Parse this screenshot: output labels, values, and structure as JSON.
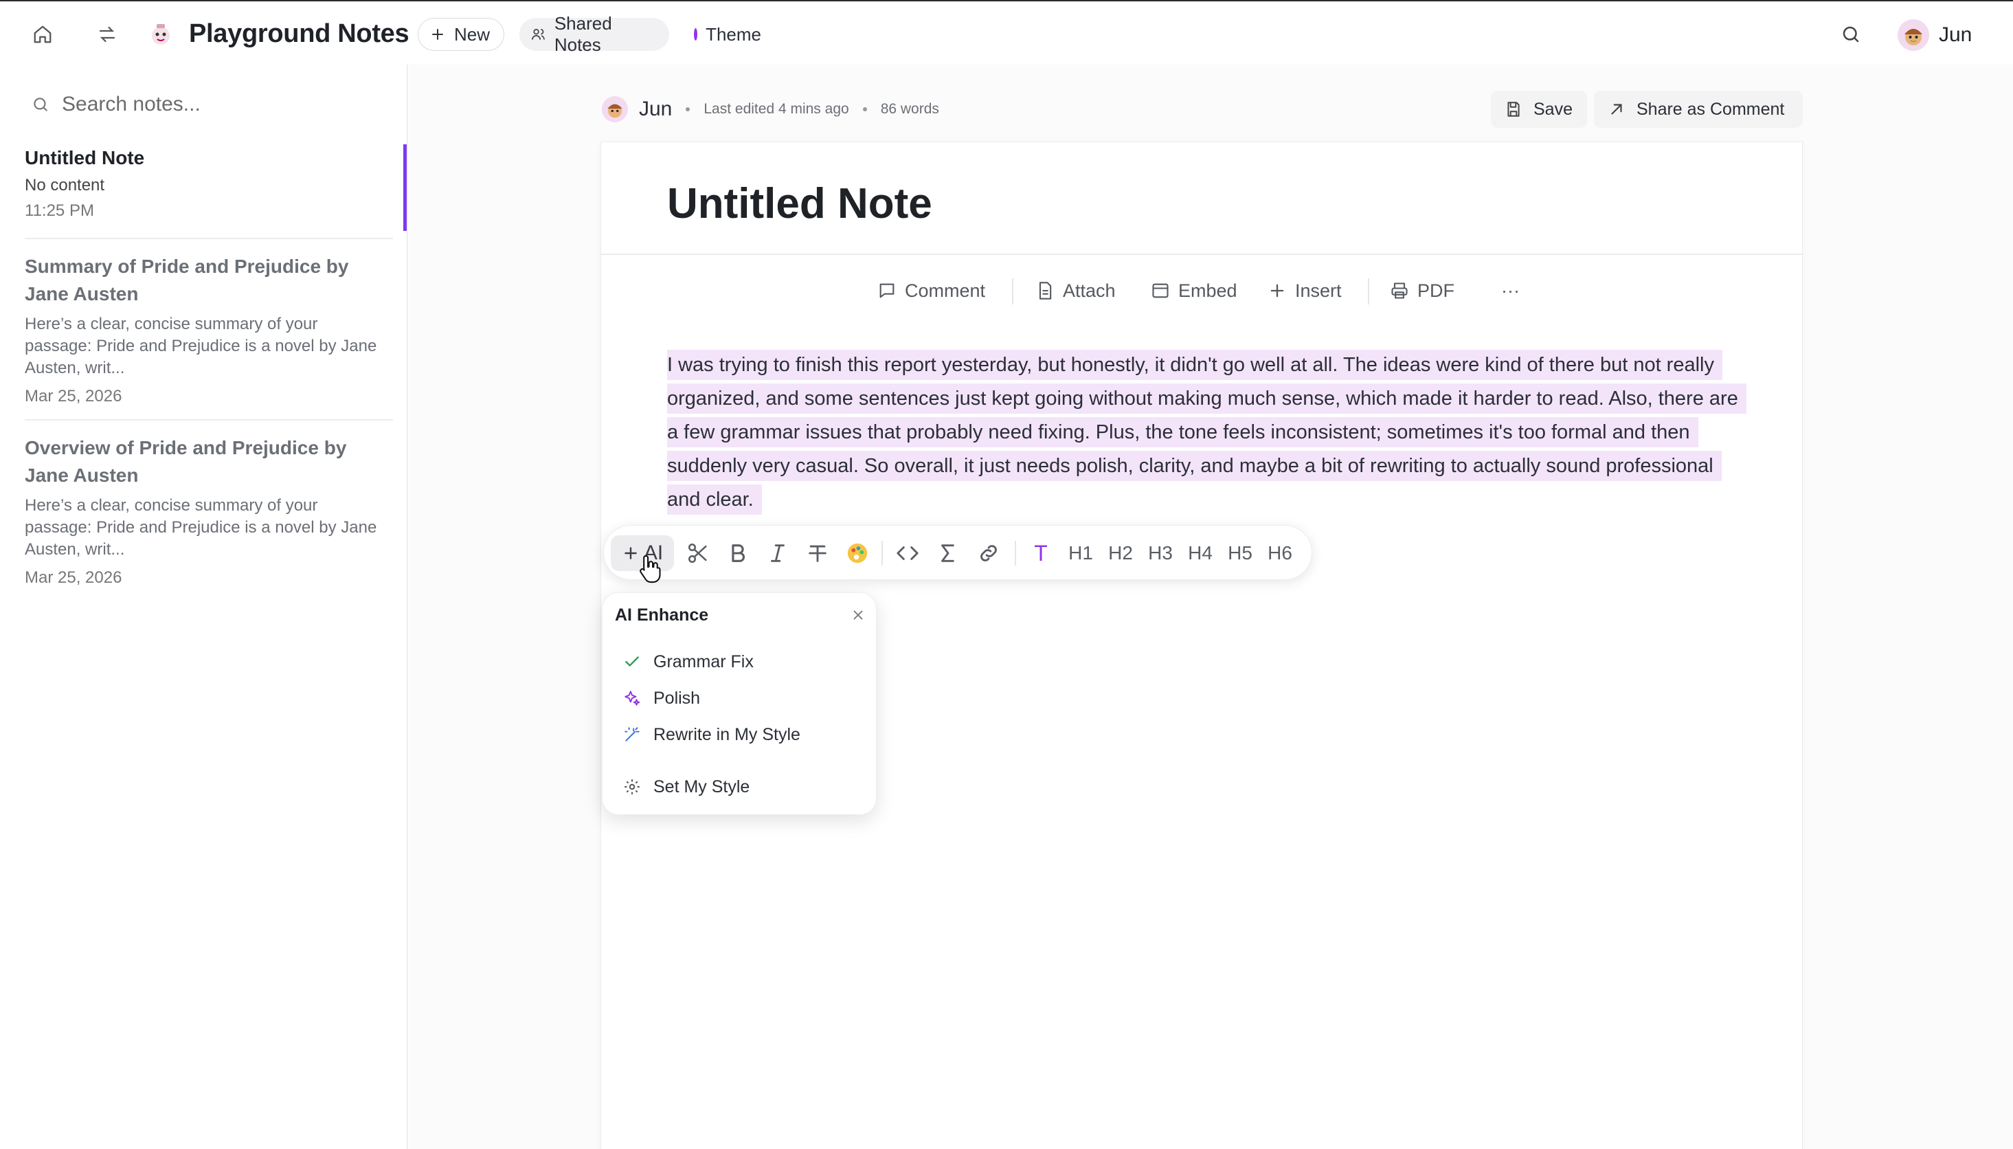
{
  "topbar": {
    "app_title": "Playground Notes",
    "new_label": "New",
    "shared_label": "Shared Notes",
    "theme_label": "Theme",
    "theme_color": "#9333ea",
    "user_name": "Jun"
  },
  "sidebar": {
    "search_placeholder": "Search notes...",
    "notes": [
      {
        "title": "Untitled Note",
        "preview": "No content",
        "date": "11:25 PM"
      },
      {
        "title": "Summary of Pride and Prejudice by Jane Austen",
        "preview": "Here’s a clear, concise summary of your passage: Pride and Prejudice is a novel by Jane Austen, writ...",
        "date": "Mar 25, 2026"
      },
      {
        "title": "Overview of Pride and Prejudice by Jane Austen",
        "preview": "Here’s a clear, concise summary of your passage: Pride and Prejudice is a novel by Jane Austen, writ...",
        "date": "Mar 25, 2026"
      }
    ]
  },
  "editor": {
    "author": "Jun",
    "last_edited": "Last edited 4 mins ago",
    "word_count": "86 words",
    "save_label": "Save",
    "share_label": "Share as Comment",
    "title": "Untitled Note",
    "toolbar": {
      "comment": "Comment",
      "attach": "Attach",
      "embed": "Embed",
      "insert": "Insert",
      "pdf": "PDF",
      "more": "···"
    },
    "body_text": "I was trying to finish this report yesterday, but honestly, it didn't go well at all. The ideas were kind of there but not really organized, and some sentences just kept going without making much sense, which made it harder to read. Also, there are a few grammar issues that probably need fixing. Plus, the tone feels inconsistent; sometimes it's too formal and then suddenly very casual. So overall, it just needs polish, clarity, and maybe a bit of rewriting to actually sound professional and clear.",
    "highlight_color": "#f3e4fa"
  },
  "format_bar": {
    "ai_label": "AI",
    "text_label": "T",
    "headings": [
      "H1",
      "H2",
      "H3",
      "H4",
      "H5",
      "H6"
    ]
  },
  "ai_menu": {
    "title": "AI Enhance",
    "items": [
      "Grammar Fix",
      "Polish",
      "Rewrite in My Style",
      "Set My Style"
    ]
  }
}
